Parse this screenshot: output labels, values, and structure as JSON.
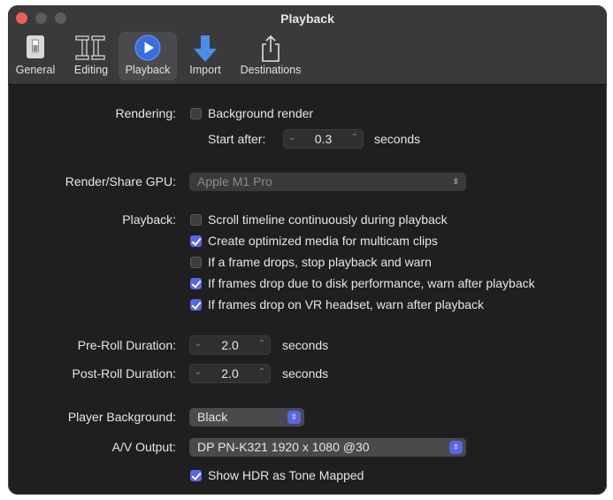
{
  "window": {
    "title": "Playback"
  },
  "toolbar": {
    "tabs": [
      {
        "label": "General",
        "icon": "general-switch-icon"
      },
      {
        "label": "Editing",
        "icon": "film-strip-icon"
      },
      {
        "label": "Playback",
        "icon": "play-circle-icon",
        "selected": true
      },
      {
        "label": "Import",
        "icon": "down-arrow-icon"
      },
      {
        "label": "Destinations",
        "icon": "share-icon"
      }
    ]
  },
  "rendering": {
    "label": "Rendering:",
    "background_render": {
      "label": "Background render",
      "checked": false
    },
    "start_after": {
      "label": "Start after:",
      "value": "0.3",
      "unit": "seconds"
    }
  },
  "gpu": {
    "label": "Render/Share GPU:",
    "value": "Apple M1 Pro",
    "enabled": false
  },
  "playback": {
    "label": "Playback:",
    "options": [
      {
        "label": "Scroll timeline continuously during playback",
        "checked": false
      },
      {
        "label": "Create optimized media for multicam clips",
        "checked": true
      },
      {
        "label": "If a frame drops, stop playback and warn",
        "checked": false
      },
      {
        "label": "If frames drop due to disk performance, warn after playback",
        "checked": true
      },
      {
        "label": "If frames drop on VR headset, warn after playback",
        "checked": true
      }
    ]
  },
  "preroll": {
    "label": "Pre-Roll Duration:",
    "value": "2.0",
    "unit": "seconds"
  },
  "postroll": {
    "label": "Post-Roll Duration:",
    "value": "2.0",
    "unit": "seconds"
  },
  "player_background": {
    "label": "Player Background:",
    "value": "Black"
  },
  "av_output": {
    "label": "A/V Output:",
    "value": "DP PN-K321 1920 x 1080 @30"
  },
  "hdr": {
    "label": "Show HDR as Tone Mapped",
    "checked": true
  },
  "colors": {
    "accent": "#5865e8",
    "window_bg": "#1f1f20",
    "toolbar_bg": "#3a3a3c"
  }
}
